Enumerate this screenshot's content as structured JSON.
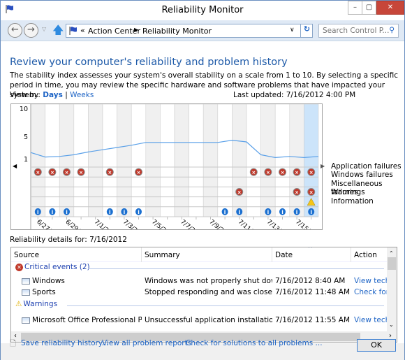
{
  "window": {
    "title": "Reliability Monitor",
    "controls": [
      "minimize",
      "maximize",
      "close"
    ]
  },
  "nav": {
    "breadcrumb": [
      "Action Center",
      "Reliability Monitor"
    ],
    "search_placeholder": "Search Control P..."
  },
  "heading": "Review your computer's reliability and problem history",
  "description": "The stability index assesses your system's overall stability on a scale from 1 to 10. By selecting a specific period in time, you may review the specific hardware and software problems that have impacted your system.",
  "view_by": {
    "label": "View by:",
    "days": "Days",
    "sep": "|",
    "weeks": "Weeks"
  },
  "last_updated": "Last updated: 7/16/2012 4:00 PM",
  "chart_data": {
    "type": "line",
    "ylim": [
      1,
      10
    ],
    "yticks": [
      "10",
      "5",
      "1"
    ],
    "days": [
      "6/27/2012",
      "6/28/2012",
      "6/29/2012",
      "6/30/2012",
      "7/1/2012",
      "7/2/2012",
      "7/3/2012",
      "7/4/2012",
      "7/5/2012",
      "7/6/2012",
      "7/7/2012",
      "7/8/2012",
      "7/9/2012",
      "7/10/2012",
      "7/11/2012",
      "7/12/2012",
      "7/13/2012",
      "7/14/2012",
      "7/15/2012",
      "7/16/2012"
    ],
    "xtick_labels": [
      "6/27/2012",
      "6/29/2012",
      "7/1/2012",
      "7/3/2012",
      "7/5/2012",
      "7/7/2012",
      "7/9/2012",
      "7/11/2012",
      "7/13/2012",
      "7/15/2012"
    ],
    "stability": [
      1.3,
      1.4,
      1.7,
      2.2,
      2.6,
      3.0,
      3.4,
      3.9,
      3.9,
      3.9,
      3.9,
      3.9,
      3.9,
      4.3,
      4.0,
      1.7,
      1.2,
      1.4,
      1.2,
      1.4
    ],
    "selected_day": "7/16/2012",
    "line_color": "#5aa0e8",
    "rows": [
      {
        "label": "Application failures",
        "icon": "error",
        "days": [
          1,
          2,
          3,
          4,
          6,
          8,
          16,
          17,
          18,
          19,
          20
        ]
      },
      {
        "label": "Windows failures",
        "icon": "error",
        "days": []
      },
      {
        "label": "Miscellaneous failures",
        "icon": "error",
        "days": [
          15,
          19,
          20
        ]
      },
      {
        "label": "Warnings",
        "icon": "warning",
        "days": [
          20
        ]
      },
      {
        "label": "Information",
        "icon": "info",
        "days": [
          1,
          2,
          3,
          6,
          7,
          8,
          14,
          15,
          17,
          18,
          19,
          20
        ]
      }
    ]
  },
  "details": {
    "title": "Reliability details for: 7/16/2012",
    "columns": [
      "Source",
      "Summary",
      "Date",
      "Action"
    ],
    "groups": [
      {
        "label": "Critical events (2)",
        "icon": "error",
        "rows": [
          {
            "source": "Windows",
            "summary": "Windows was not properly shut down",
            "date": "7/16/2012 8:40 AM",
            "action": "View  techn"
          },
          {
            "source": "Sports",
            "summary": "Stopped responding and was closed",
            "date": "7/16/2012 11:48 AM",
            "action": "Check for a"
          }
        ]
      },
      {
        "label": "Warnings",
        "icon": "warning",
        "rows": [
          {
            "source": "Microsoft Office Professional Plus ...",
            "summary": "Unsuccessful application installation",
            "date": "7/16/2012 11:55 AM",
            "action": "View  techn"
          }
        ]
      }
    ]
  },
  "footer": {
    "save": "Save reliability history...",
    "view_all": "View all problem reports",
    "check": "Check for solutions to all problems ...",
    "ok": "OK"
  }
}
